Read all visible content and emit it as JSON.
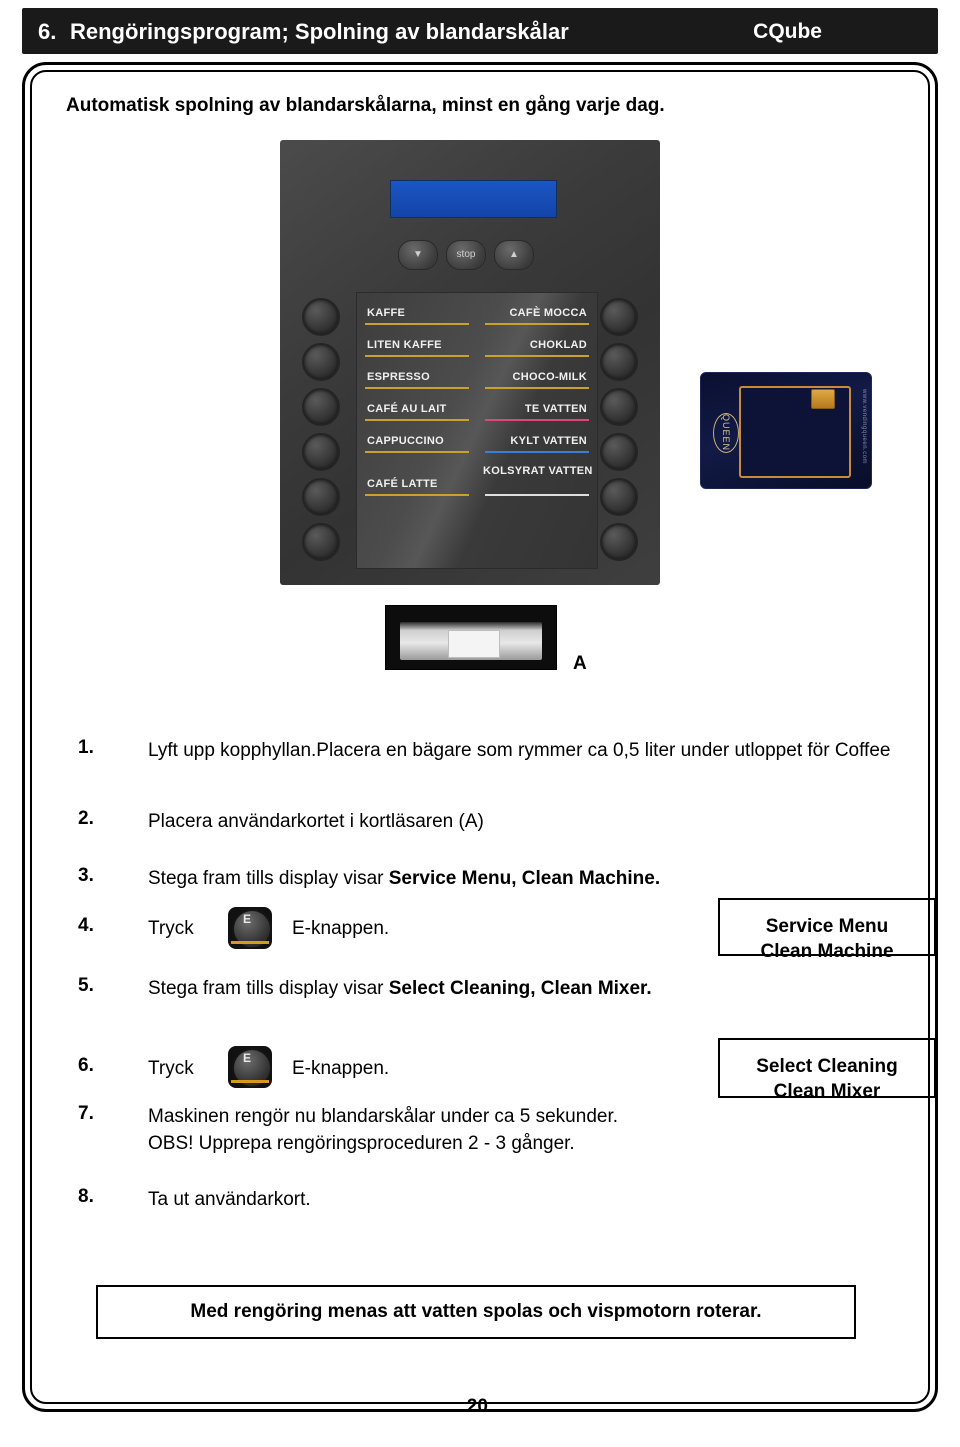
{
  "header": {
    "number": "6.",
    "title": "Rengöringsprogram; Spolning av blandarskålar",
    "brand": "CQube"
  },
  "subtitle": "Automatisk spolning av blandarskålarna,  minst en gång varje dag.",
  "machine": {
    "top_buttons": [
      "cup-down-icon",
      "stop",
      "cup-up-icon"
    ],
    "stop_label": "stop",
    "drinks_left": [
      "KAFFE",
      "LITEN KAFFE",
      "ESPRESSO",
      "CAFÉ AU LAIT",
      "CAPPUCCINO",
      "CAFÉ LATTE"
    ],
    "drinks_right": [
      "CAFÈ MOCCA",
      "CHOKLAD",
      "CHOCO-MILK",
      "TE VATTEN",
      "KYLT VATTEN",
      "KOLSYRAT VATTEN"
    ]
  },
  "card": {
    "brand": "QUEEN",
    "url": "www.vendingqueen.com"
  },
  "label_a": "A",
  "steps": [
    {
      "num": "1.",
      "text_plain": "Lyft upp kopphyllan.Placera en bägare som rymmer ca 0,5 liter under utloppet för Coffee"
    },
    {
      "num": "2.",
      "text_plain": "Placera användarkortet i kortläsaren (A)",
      "bold_tail": "(A)"
    },
    {
      "num": "3.",
      "text_lead": "Stega fram tills display visar ",
      "text_bold": "Service Menu, Clean Machine."
    },
    {
      "num": "4.",
      "text_lead": "Tryck",
      "text_tail": "E-knappen."
    },
    {
      "num": "5.",
      "text_lead": "Stega fram tills display visar ",
      "text_bold": "Select Cleaning, Clean Mixer."
    },
    {
      "num": "6.",
      "text_lead": "Tryck",
      "text_tail": "E-knappen."
    },
    {
      "num": "7.",
      "line1": "Maskinen rengör nu blandarskålar under ca 5 sekunder.",
      "line2": "OBS! Upprepa rengöringsproceduren 2 - 3 gånger."
    },
    {
      "num": "8.",
      "text_plain": "Ta ut användarkort."
    }
  ],
  "eknapp_label": "E",
  "display_1": {
    "line1": "Service Menu",
    "line2": "Clean Machine"
  },
  "display_2": {
    "line1": "Select Cleaning",
    "line2": "Clean Mixer"
  },
  "footer_note": "Med rengöring menas att vatten spolas och vispmotorn roterar.",
  "page_number": "20.",
  "colors": {
    "header_bg": "#1a1a1a",
    "accent_gold": "#c9a227",
    "display_blue": "#1344a8"
  }
}
